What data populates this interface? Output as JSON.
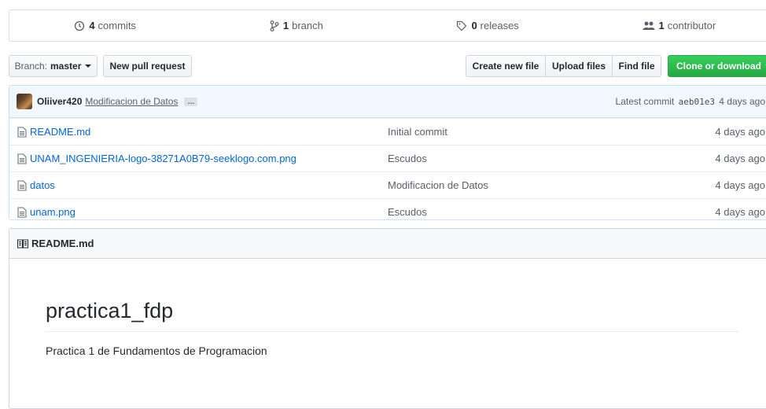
{
  "numbers_summary": {
    "commits": {
      "count": "4",
      "label": "commits",
      "icon": "history-icon"
    },
    "branches": {
      "count": "1",
      "label": "branch",
      "icon": "branch-icon"
    },
    "releases": {
      "count": "0",
      "label": "releases",
      "icon": "tag-icon"
    },
    "contributors": {
      "count": "1",
      "label": "contributor",
      "icon": "people-icon"
    }
  },
  "toolbar": {
    "branch_prefix": "Branch:",
    "branch_name": "master",
    "new_pull_request": "New pull request",
    "create_new_file": "Create new file",
    "upload_files": "Upload files",
    "find_file": "Find file",
    "clone_or_download": "Clone or download"
  },
  "latest_commit": {
    "author": "Oliiver420",
    "message": "Modificacion de Datos",
    "ellipsis": "…",
    "prefix": "Latest commit",
    "sha": "aeb01e3",
    "age": "4 days ago"
  },
  "files": [
    {
      "name": "README.md",
      "commit": "Initial commit",
      "age": "4 days ago"
    },
    {
      "name": "UNAM_INGENIERIA-logo-38271A0B79-seeklogo.com.png",
      "commit": "Escudos",
      "age": "4 days ago"
    },
    {
      "name": "datos",
      "commit": "Modificacion de Datos",
      "age": "4 days ago"
    },
    {
      "name": "unam.png",
      "commit": "Escudos",
      "age": "4 days ago"
    }
  ],
  "readme": {
    "header": "README.md",
    "title": "practica1_fdp",
    "body": "Practica 1 de Fundamentos de Programacion"
  },
  "colors": {
    "link": "#0366d6",
    "green_button": "#28a745",
    "commit_bar_bg": "#f1f8ff",
    "border": "#d1d5da"
  }
}
